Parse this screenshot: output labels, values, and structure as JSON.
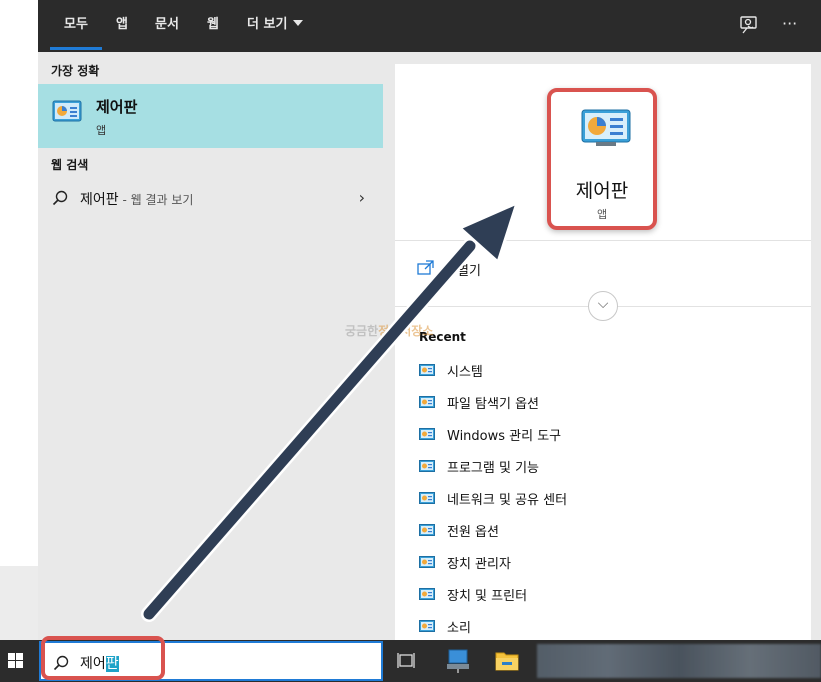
{
  "tabs": [
    {
      "label": "모두",
      "active": true
    },
    {
      "label": "앱",
      "active": false
    },
    {
      "label": "문서",
      "active": false
    },
    {
      "label": "웹",
      "active": false
    },
    {
      "label": "더 보기",
      "active": false
    }
  ],
  "top_icons": [
    "feedback-icon",
    "more-options-icon"
  ],
  "more_options_glyph": "···",
  "left": {
    "best_match_title": "가장 정확",
    "best_match": {
      "name": "제어판",
      "type": "앱",
      "icon": "control-panel-icon"
    },
    "web_search_title": "웹 검색",
    "web_result": {
      "query": "제어판",
      "suffix": " - 웹 결과 보기",
      "chevron": "›"
    }
  },
  "right": {
    "app": {
      "name": "제어판",
      "type": "앱",
      "icon": "control-panel-icon"
    },
    "open_label": "열기",
    "expand_glyph": "⌵",
    "recent_title": "Recent",
    "recent_items": [
      "시스템",
      "파일 탐색기 옵션",
      "Windows 관리 도구",
      "프로그램 및 기능",
      "네트워크 및 공유 센터",
      "전원 옵션",
      "장치 관리자",
      "장치 및 프린터",
      "소리"
    ]
  },
  "watermark": {
    "line1": "궁금한",
    "line2": "정보저장소"
  },
  "taskbar": {
    "search_value": "제어",
    "search_value_highlight": "판",
    "icons": [
      "windows-start-icon",
      "task-view-icon",
      "network-drive-icon",
      "file-explorer-icon"
    ]
  },
  "colors": {
    "accent": "#1f7bd6",
    "selection": "#a6dfe3",
    "annotation_red": "#d9534f",
    "annotation_arrow": "#2f3e55"
  }
}
